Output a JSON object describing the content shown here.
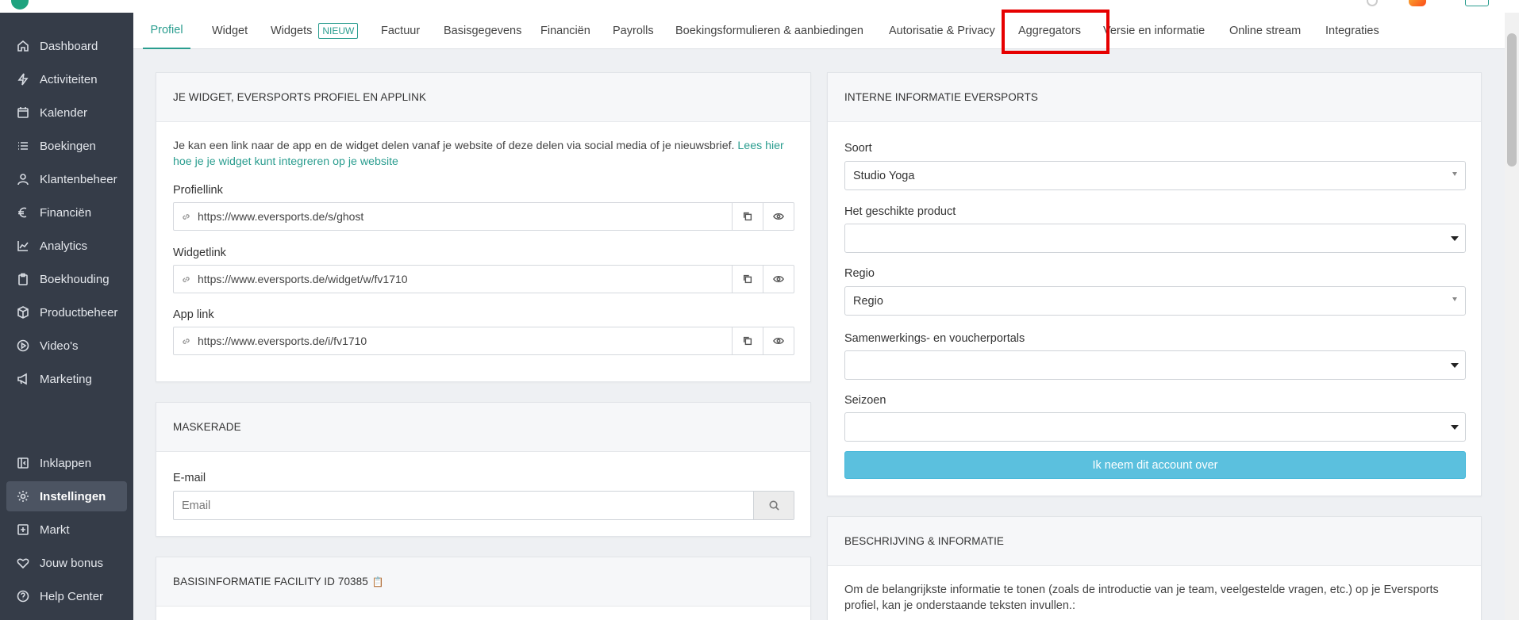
{
  "sidebar": {
    "items": [
      {
        "label": "Dashboard",
        "icon": "home-icon"
      },
      {
        "label": "Activiteiten",
        "icon": "lightning-icon"
      },
      {
        "label": "Kalender",
        "icon": "calendar-icon"
      },
      {
        "label": "Boekingen",
        "icon": "list-icon"
      },
      {
        "label": "Klantenbeheer",
        "icon": "user-icon"
      },
      {
        "label": "Financiën",
        "icon": "euro-icon"
      },
      {
        "label": "Analytics",
        "icon": "chart-line-icon"
      },
      {
        "label": "Boekhouding",
        "icon": "clipboard-icon"
      },
      {
        "label": "Productbeheer",
        "icon": "box-icon"
      },
      {
        "label": "Video's",
        "icon": "play-circle-icon"
      },
      {
        "label": "Marketing",
        "icon": "megaphone-icon"
      }
    ],
    "bottom_items": [
      {
        "label": "Inklappen",
        "icon": "collapse-icon"
      },
      {
        "label": "Instellingen",
        "icon": "gear-icon",
        "active": true
      },
      {
        "label": "Markt",
        "icon": "plus-square-icon"
      },
      {
        "label": "Jouw bonus",
        "icon": "heart-icon"
      },
      {
        "label": "Help Center",
        "icon": "help-circle-icon"
      }
    ]
  },
  "tabs": [
    {
      "label": "Profiel",
      "active": true
    },
    {
      "label": "Widget"
    },
    {
      "label": "Widgets",
      "badge": "NIEUW"
    },
    {
      "label": "Factuur"
    },
    {
      "label": "Basisgegevens"
    },
    {
      "label": "Financiën"
    },
    {
      "label": "Payrolls"
    },
    {
      "label": "Boekingsformulieren & aanbiedingen"
    },
    {
      "label": "Autorisatie & Privacy"
    },
    {
      "label": "Aggregators",
      "highlighted": true
    },
    {
      "label": "Versie en informatie"
    },
    {
      "label": "Online stream"
    },
    {
      "label": "Integraties"
    }
  ],
  "widget_card": {
    "title": "JE WIDGET, EVERSPORTS PROFIEL EN APPLINK",
    "intro": "Je kan een link naar de app en de widget delen vanaf je website of deze delen via social media of je nieuwsbrief.",
    "intro_link": "Lees hier hoe je je widget kunt integreren op je website",
    "profile_label": "Profiellink",
    "profile_url": "https://www.eversports.de/s/ghost",
    "widget_label": "Widgetlink",
    "widget_url": "https://www.eversports.de/widget/w/fv1710",
    "app_label": "App link",
    "app_url": "https://www.eversports.de/i/fv1710"
  },
  "masquerade_card": {
    "title": "MASKERADE",
    "email_label": "E-mail",
    "email_placeholder": "Email"
  },
  "basis_card": {
    "title": "BASISINFORMATIE FACILITY ID 70385"
  },
  "internal_card": {
    "title": "INTERNE INFORMATIE EVERSPORTS",
    "type_label": "Soort",
    "type_value": "Studio Yoga",
    "product_label": "Het geschikte product",
    "product_value": "",
    "region_label": "Regio",
    "region_value": "Regio",
    "portals_label": "Samenwerkings- en voucherportals",
    "portals_value": "",
    "season_label": "Seizoen",
    "season_value": "",
    "takeover_button": "Ik neem dit account over"
  },
  "description_card": {
    "title": "BESCHRIJVING & INFORMATIE",
    "text": "Om de belangrijkste informatie te tonen (zoals de introductie van je team, veelgestelde vragen, etc.) op je Eversports profiel, kan je onderstaande teksten invullen.:"
  },
  "colors": {
    "accent": "#2a9d8f",
    "sidebar_bg": "#353c48",
    "primary_button": "#5bc0de",
    "highlight": "#e60000"
  }
}
